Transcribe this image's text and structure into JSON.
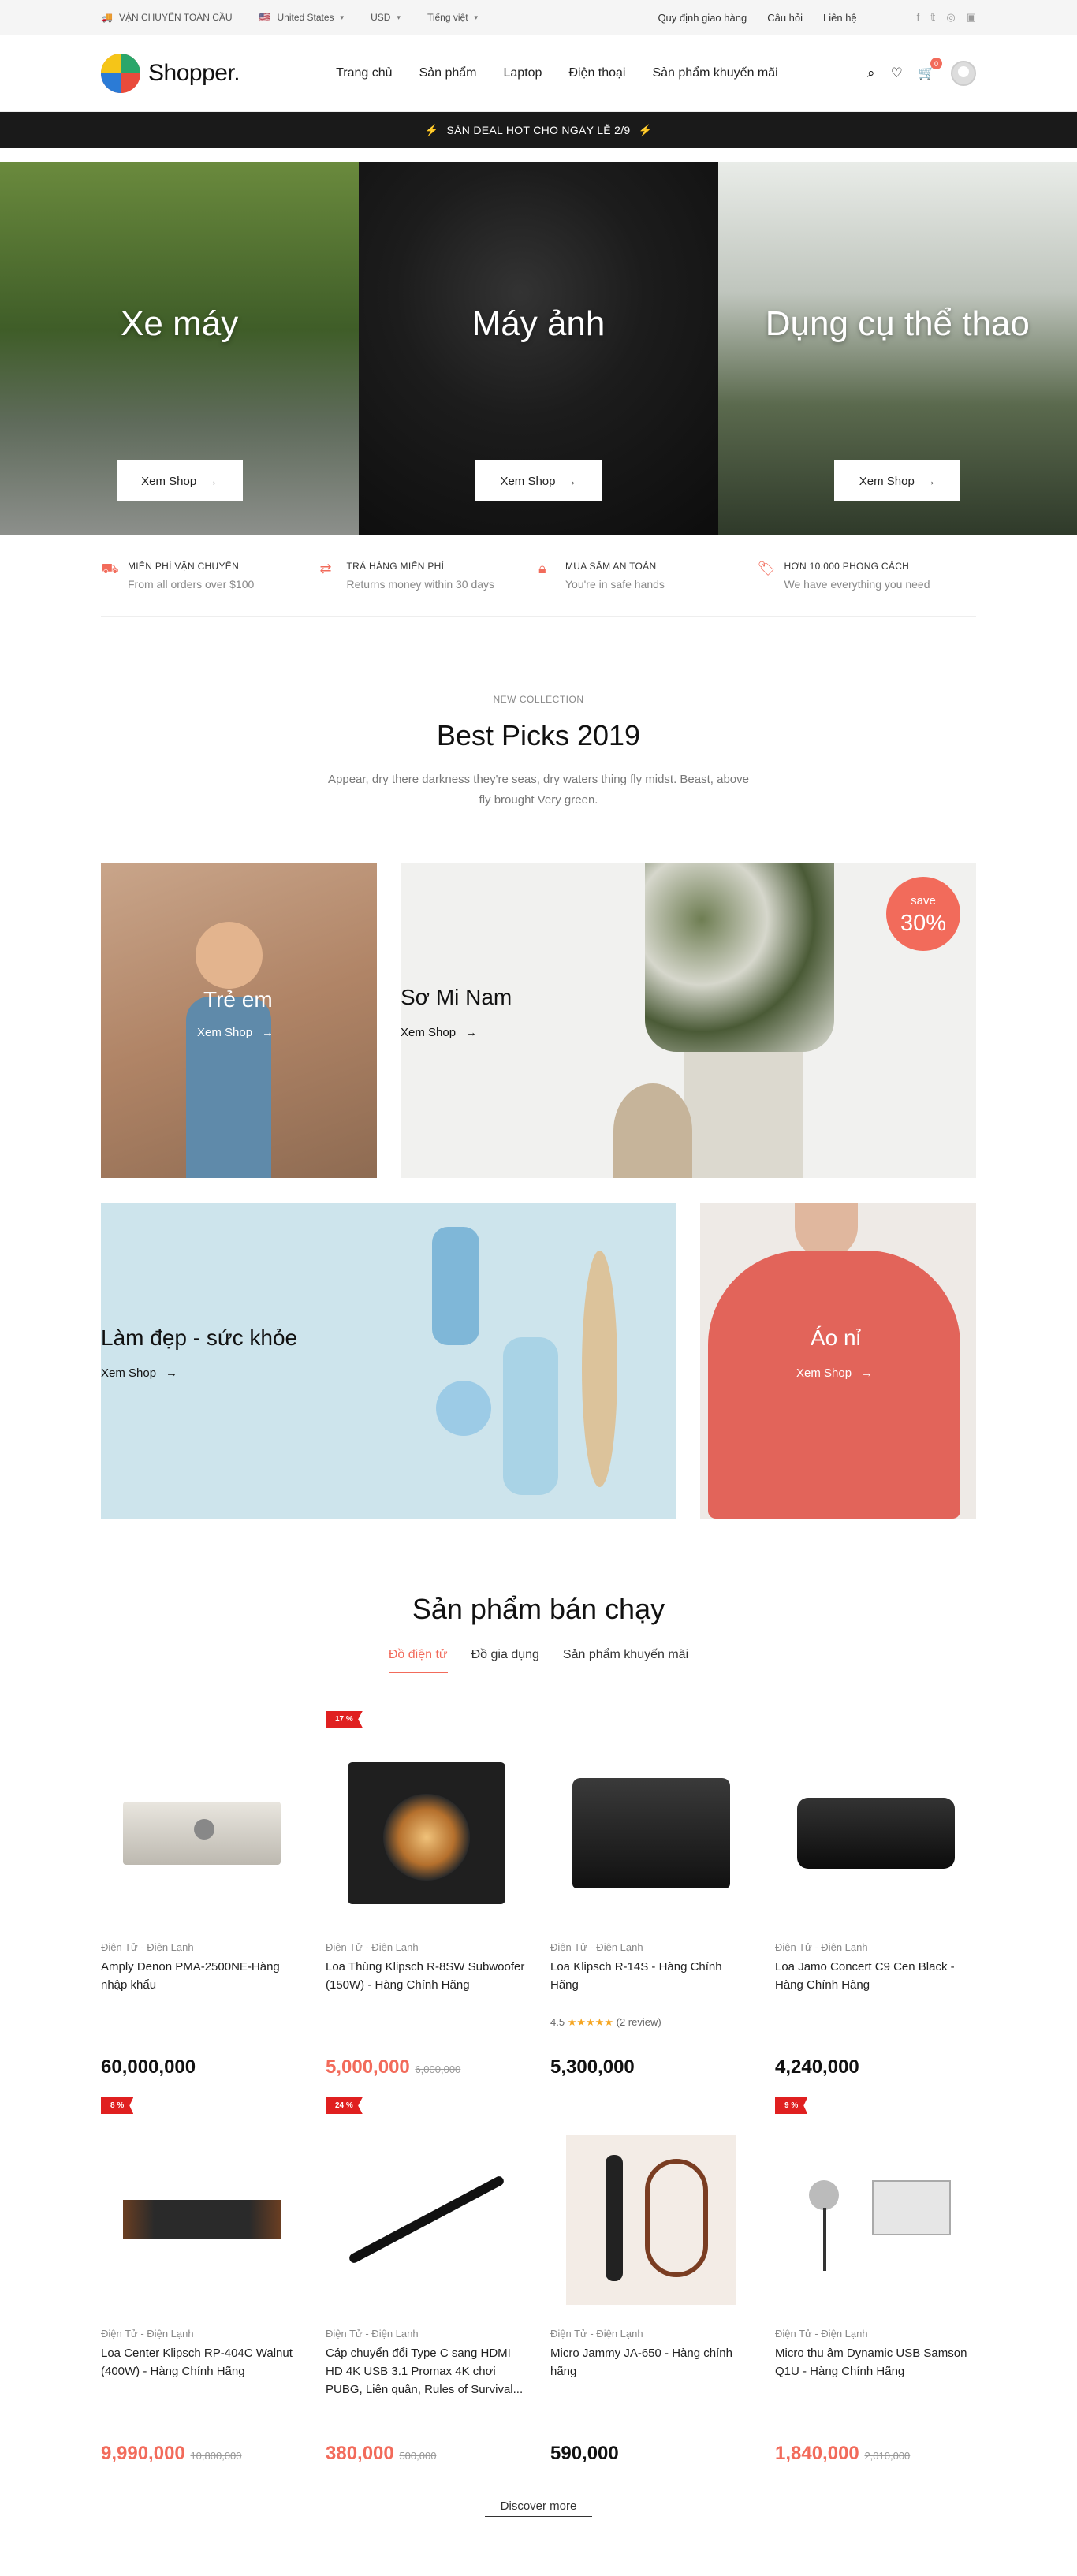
{
  "topbar": {
    "shipping": "VẬN CHUYỂN TOÀN CẦU",
    "country": "United States",
    "currency": "USD",
    "language": "Tiếng việt",
    "links": [
      "Quy định giao hàng",
      "Câu hỏi",
      "Liên hệ"
    ],
    "social": [
      "facebook-icon",
      "twitter-icon",
      "instagram-icon",
      "linkedin-icon"
    ]
  },
  "header": {
    "brand": "Shopper.",
    "nav": [
      "Trang chủ",
      "Sản phẩm",
      "Laptop",
      "Điện thoại",
      "Sản phẩm khuyến mãi"
    ],
    "cart_count": "0"
  },
  "promo": {
    "text": "SĂN DEAL HOT CHO NGÀY LỄ 2/9"
  },
  "hero": [
    {
      "title": "Xe máy",
      "button": "Xem Shop"
    },
    {
      "title": "Máy ảnh",
      "button": "Xem Shop"
    },
    {
      "title": "Dụng cụ thể thao",
      "button": "Xem Shop"
    }
  ],
  "features": [
    {
      "icon": "truck-icon",
      "title": "MIỄN PHÍ VẬN CHUYỂN",
      "text": "From all orders over $100"
    },
    {
      "icon": "return-icon",
      "title": "TRẢ HÀNG MIỄN PHÍ",
      "text": "Returns money within 30 days"
    },
    {
      "icon": "lock-icon",
      "title": "MUA SẮM AN TOÀN",
      "text": "You're in safe hands"
    },
    {
      "icon": "tag-icon",
      "title": "HƠN 10.000 PHONG CÁCH",
      "text": "We have everything you need"
    }
  ],
  "best_picks": {
    "subtitle": "NEW COLLECTION",
    "title": "Best Picks 2019",
    "description": "Appear, dry there darkness they're seas, dry waters thing fly midst. Beast, above fly brought Very green.",
    "tiles": [
      {
        "name": "Trẻ em",
        "link": "Xem Shop"
      },
      {
        "name": "Sơ Mi Nam",
        "link": "Xem Shop",
        "save_label": "save",
        "save_value": "30%"
      },
      {
        "name": "Làm đẹp - sức khỏe",
        "link": "Xem Shop"
      },
      {
        "name": "Áo nỉ",
        "link": "Xem Shop"
      }
    ]
  },
  "bestsellers": {
    "title": "Sản phẩm bán chạy",
    "tabs": [
      "Đồ điện tử",
      "Đồ gia dụng",
      "Sản phẩm khuyến mãi"
    ],
    "products": [
      {
        "category": "Điện Tử - Điện Lạnh",
        "name": "Amply Denon PMA-2500NE-Hàng nhập khẩu",
        "price": "60,000,000",
        "old_price": "",
        "tag": "",
        "rating": ""
      },
      {
        "category": "Điện Tử - Điện Lạnh",
        "name": "Loa Thùng Klipsch R-8SW Subwoofer (150W) - Hàng Chính Hãng",
        "price": "5,000,000",
        "old_price": "6,000,000",
        "tag": "17 %",
        "rating": ""
      },
      {
        "category": "Điện Tử - Điện Lạnh",
        "name": "Loa Klipsch R-14S - Hàng Chính Hãng",
        "price": "5,300,000",
        "old_price": "",
        "tag": "",
        "rating": "4.5",
        "stars": "★★★★★",
        "reviews": "(2 review)"
      },
      {
        "category": "Điện Tử - Điện Lạnh",
        "name": "Loa Jamo Concert C9 Cen Black - Hàng Chính Hãng",
        "price": "4,240,000",
        "old_price": "",
        "tag": "",
        "rating": ""
      },
      {
        "category": "Điện Tử - Điện Lạnh",
        "name": "Loa Center Klipsch RP-404C Walnut (400W) - Hàng Chính Hãng",
        "price": "9,990,000",
        "old_price": "10,800,000",
        "tag": "8 %",
        "rating": ""
      },
      {
        "category": "Điện Tử - Điện Lạnh",
        "name": "Cáp chuyển đổi Type C sang HDMI HD 4K USB 3.1 Promax 4K chơi PUBG, Liên quân, Rules of Survival...",
        "price": "380,000",
        "old_price": "500,000",
        "tag": "24 %",
        "rating": ""
      },
      {
        "category": "Điện Tử - Điện Lạnh",
        "name": "Micro Jammy JA-650 - Hàng chính hãng",
        "price": "590,000",
        "old_price": "",
        "tag": "",
        "rating": ""
      },
      {
        "category": "Điện Tử - Điện Lạnh",
        "name": "Micro thu âm Dynamic USB Samson Q1U - Hàng Chính Hãng",
        "price": "1,840,000",
        "old_price": "2,010,000",
        "tag": "9 %",
        "rating": ""
      }
    ],
    "discover": "Discover more"
  }
}
